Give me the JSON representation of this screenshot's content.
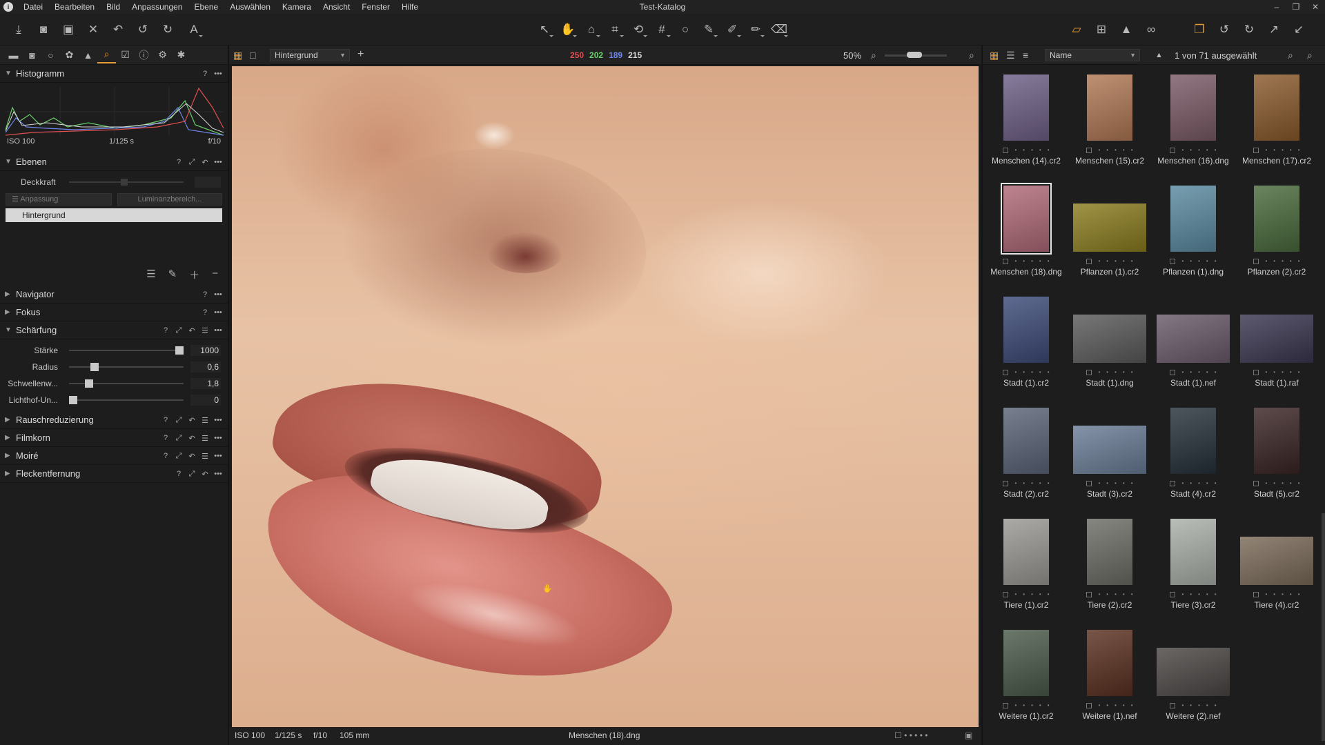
{
  "window": {
    "title": "Test-Katalog",
    "min": "–",
    "max": "❐",
    "close": "✕"
  },
  "menu": [
    "Datei",
    "Bearbeiten",
    "Bild",
    "Anpassungen",
    "Ebene",
    "Auswählen",
    "Kamera",
    "Ansicht",
    "Fenster",
    "Hilfe"
  ],
  "left_panel": {
    "histogram": {
      "title": "Histogramm",
      "iso": "ISO 100",
      "shutter": "1/125 s",
      "aperture": "f/10"
    },
    "layers": {
      "title": "Ebenen",
      "opacity_label": "Deckkraft",
      "adjust_label": "Anpassung",
      "luminance_label": "Luminanzbereich...",
      "layer_name": "Hintergrund"
    },
    "sections": {
      "navigator": "Navigator",
      "focus": "Fokus",
      "sharpening": "Schärfung",
      "noise": "Rauschreduzierung",
      "grain": "Filmkorn",
      "moire": "Moiré",
      "spot": "Fleckentfernung"
    },
    "sharpening_sliders": [
      {
        "label": "Stärke",
        "value": "1000",
        "fraction": 1.0
      },
      {
        "label": "Radius",
        "value": "0,6",
        "fraction": 0.2
      },
      {
        "label": "Schwellenw...",
        "value": "1,8",
        "fraction": 0.15
      },
      {
        "label": "Lichthof-Un...",
        "value": "0",
        "fraction": 0.0
      }
    ]
  },
  "viewer": {
    "layer_select": "Hintergrund",
    "rgb": {
      "r": "250",
      "g": "202",
      "b": "189",
      "l": "215"
    },
    "zoom": "50%",
    "status": {
      "iso": "ISO 100",
      "shutter": "1/125 s",
      "aperture": "f/10",
      "focal": "105 mm",
      "filename": "Menschen (18).dng"
    }
  },
  "browser": {
    "sort": "Name",
    "count": "1 von 71 ausgewählt",
    "thumbnails": [
      {
        "name": "Menschen (14).cr2",
        "color": "#6e5f86",
        "orientation": "portrait"
      },
      {
        "name": "Menschen (15).cr2",
        "color": "#b07855",
        "orientation": "portrait"
      },
      {
        "name": "Menschen (16).dng",
        "color": "#7a5a66",
        "orientation": "portrait"
      },
      {
        "name": "Menschen (17).cr2",
        "color": "#8a5a2c",
        "orientation": "portrait"
      },
      {
        "name": "Menschen (18).dng",
        "color": "#b06a78",
        "orientation": "portrait",
        "selected": true
      },
      {
        "name": "Pflanzen (1).cr2",
        "color": "#8a7c1e",
        "orientation": "landscape"
      },
      {
        "name": "Pflanzen (1).dng",
        "color": "#5a8aa0",
        "orientation": "portrait"
      },
      {
        "name": "Pflanzen (2).cr2",
        "color": "#4a6a3c",
        "orientation": "portrait"
      },
      {
        "name": "Stadt (1).cr2",
        "color": "#3c4a78",
        "orientation": "portrait"
      },
      {
        "name": "Stadt (1).dng",
        "color": "#5a5a5a",
        "orientation": "landscape"
      },
      {
        "name": "Stadt (1).nef",
        "color": "#6a5a6a",
        "orientation": "landscape"
      },
      {
        "name": "Stadt (1).raf",
        "color": "#3a3650",
        "orientation": "landscape"
      },
      {
        "name": "Stadt (2).cr2",
        "color": "#5a6478",
        "orientation": "portrait"
      },
      {
        "name": "Stadt (3).cr2",
        "color": "#6a7c96",
        "orientation": "landscape"
      },
      {
        "name": "Stadt (4).cr2",
        "color": "#26303a",
        "orientation": "portrait"
      },
      {
        "name": "Stadt (5).cr2",
        "color": "#3a2424",
        "orientation": "portrait"
      },
      {
        "name": "Tiere (1).cr2",
        "color": "#9a9894",
        "orientation": "portrait"
      },
      {
        "name": "Tiere (2).cr2",
        "color": "#6c6c66",
        "orientation": "portrait"
      },
      {
        "name": "Tiere (3).cr2",
        "color": "#aab0aa",
        "orientation": "portrait"
      },
      {
        "name": "Tiere (4).cr2",
        "color": "#7a6a58",
        "orientation": "landscape"
      },
      {
        "name": "Weitere (1).cr2",
        "color": "#4a5a4a",
        "orientation": "portrait"
      },
      {
        "name": "Weitere (1).nef",
        "color": "#5a3020",
        "orientation": "portrait"
      },
      {
        "name": "Weitere (2).nef",
        "color": "#4a4644",
        "orientation": "landscape"
      }
    ]
  },
  "colors": {
    "accent": "#e39a32",
    "red": "#e05050",
    "green": "#6bd06b",
    "blue": "#6f86e8"
  }
}
